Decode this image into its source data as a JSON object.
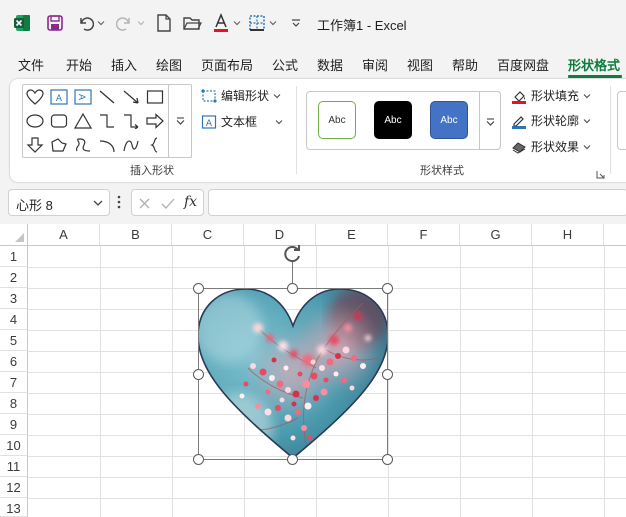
{
  "window": {
    "title": "工作簿1  -  Excel"
  },
  "tabs": [
    {
      "label": "文件"
    },
    {
      "label": "开始"
    },
    {
      "label": "插入"
    },
    {
      "label": "绘图"
    },
    {
      "label": "页面布局"
    },
    {
      "label": "公式"
    },
    {
      "label": "数据"
    },
    {
      "label": "审阅"
    },
    {
      "label": "视图"
    },
    {
      "label": "帮助"
    },
    {
      "label": "百度网盘"
    },
    {
      "label": "形状格式"
    }
  ],
  "ribbon": {
    "insert_shapes": {
      "edit_shape": "编辑形状",
      "textbox": "文本框",
      "group_label": "插入形状"
    },
    "shape_styles": {
      "swatches": [
        {
          "label": "Abc"
        },
        {
          "label": "Abc"
        },
        {
          "label": "Abc"
        }
      ],
      "fill": "形状填充",
      "outline": "形状轮廓",
      "effects": "形状效果",
      "group_label": "形状样式"
    }
  },
  "formula_bar": {
    "name_box": "心形 8",
    "fx": "fx",
    "formula": ""
  },
  "columns": [
    "A",
    "B",
    "C",
    "D",
    "E",
    "F",
    "G",
    "H"
  ],
  "rows": [
    "1",
    "2",
    "3",
    "4",
    "5",
    "6",
    "7",
    "8",
    "9",
    "10",
    "11",
    "12",
    "13"
  ],
  "colors": {
    "accent": "#107c41",
    "font_red": "#e81123",
    "outline_blue": "#2e75b6",
    "swatch_blue": "#4472c4"
  }
}
